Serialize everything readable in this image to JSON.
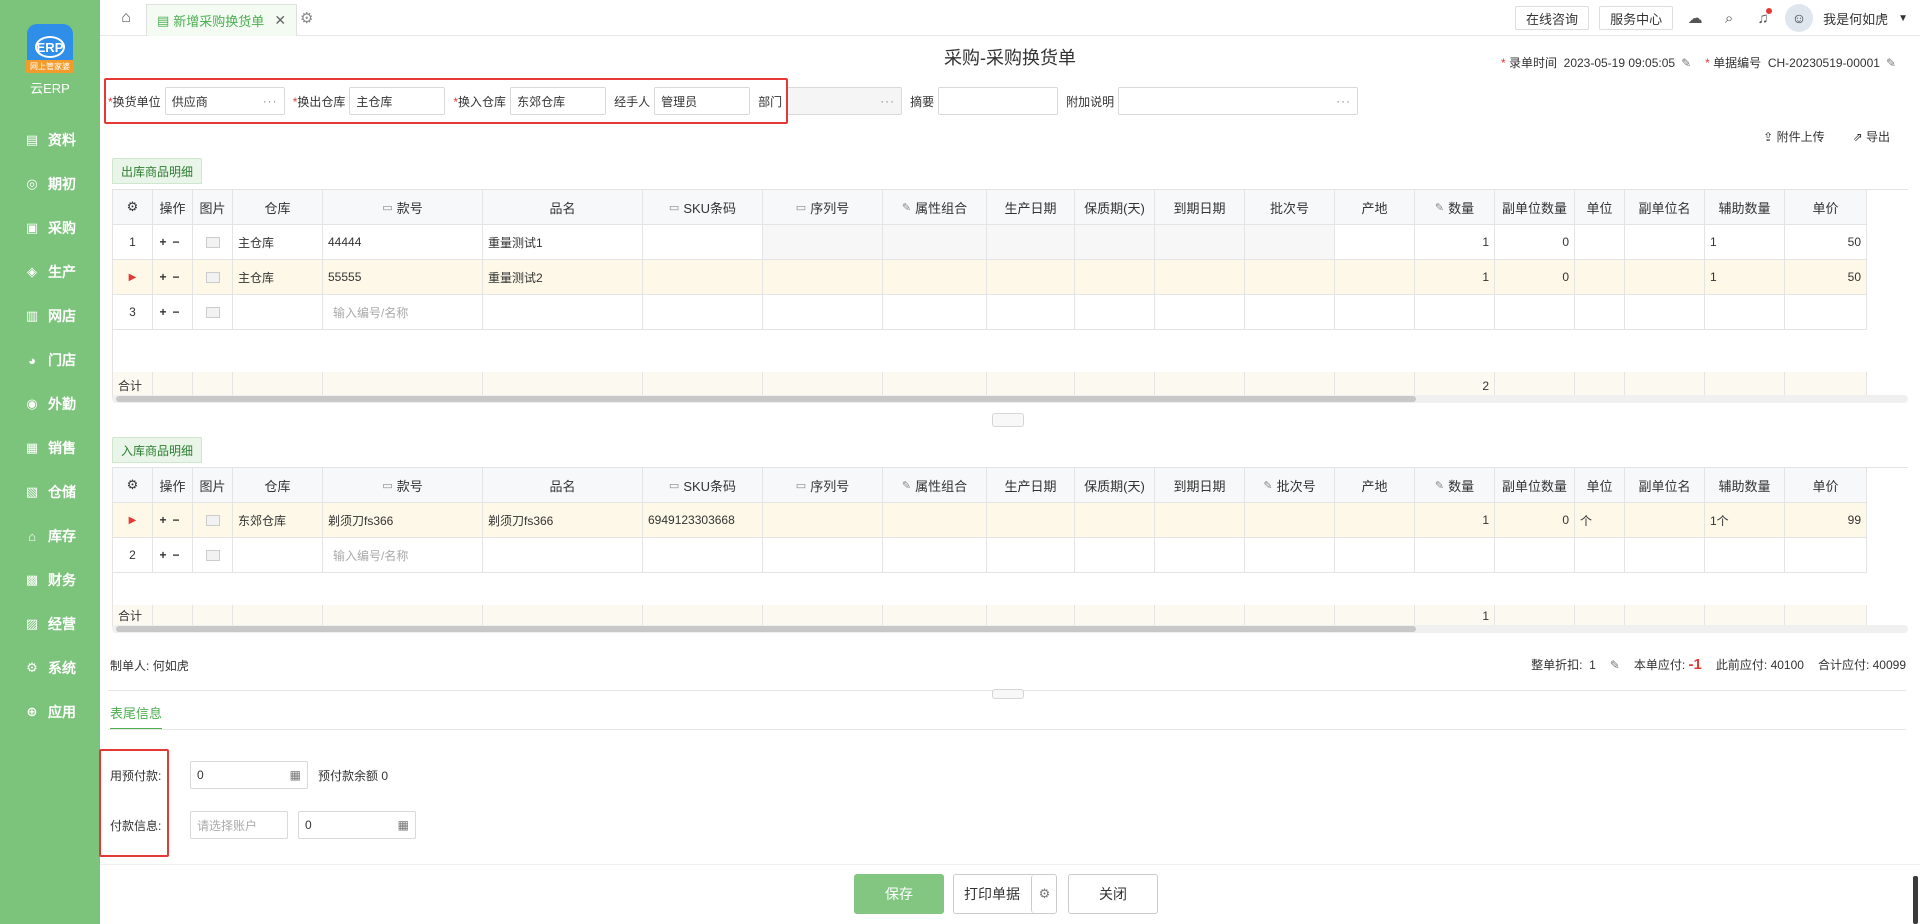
{
  "app": {
    "logo_text": "云ERP",
    "logo_tag": "网上管家婆",
    "logo_mark": "ERP"
  },
  "sidebar": {
    "items": [
      {
        "label": "资料",
        "icon": "file-icon"
      },
      {
        "label": "期初",
        "icon": "clock-icon"
      },
      {
        "label": "采购",
        "icon": "cart-icon"
      },
      {
        "label": "生产",
        "icon": "factory-icon"
      },
      {
        "label": "网店",
        "icon": "shop-icon"
      },
      {
        "label": "门店",
        "icon": "store-icon"
      },
      {
        "label": "外勤",
        "icon": "location-icon"
      },
      {
        "label": "销售",
        "icon": "chart-icon"
      },
      {
        "label": "仓储",
        "icon": "warehouse-icon"
      },
      {
        "label": "库存",
        "icon": "home-icon"
      },
      {
        "label": "财务",
        "icon": "finance-icon"
      },
      {
        "label": "经营",
        "icon": "business-icon"
      },
      {
        "label": "系统",
        "icon": "gear-icon"
      },
      {
        "label": "应用",
        "icon": "plus-icon"
      }
    ]
  },
  "topbar": {
    "tab_label": "新增采购换货单",
    "online_consult": "在线咨询",
    "service_center": "服务中心",
    "user_name": "我是何如虎"
  },
  "page": {
    "title": "采购-采购换货单",
    "entry_time_label": "录单时间",
    "entry_time": "2023-05-19 09:05:05",
    "doc_no_label": "单据编号",
    "doc_no": "CH-20230519-00001"
  },
  "form": {
    "unit_label": "换货单位",
    "unit_value": "供应商",
    "out_wh_label": "换出仓库",
    "out_wh_value": "主仓库",
    "in_wh_label": "换入仓库",
    "in_wh_value": "东郊仓库",
    "handler_label": "经手人",
    "handler_value": "管理员",
    "dept_label": "部门",
    "dept_value": "",
    "summary_label": "摘要",
    "summary_value": "",
    "remark_label": "附加说明",
    "remark_value": "",
    "attach_label": "附件上传",
    "export_label": "导出"
  },
  "columns": [
    "操作",
    "图片",
    "仓库",
    "款号",
    "品名",
    "SKU条码",
    "序列号",
    "属性组合",
    "生产日期",
    "保质期(天)",
    "到期日期",
    "批次号",
    "产地",
    "数量",
    "副单位数量",
    "单位",
    "副单位名",
    "辅助数量",
    "单价"
  ],
  "outbound": {
    "section_label": "出库商品明细",
    "rows": [
      {
        "idx": "1",
        "wh": "主仓库",
        "code": "44444",
        "name": "重量测试1",
        "sku": "",
        "qty": "1",
        "subqty": "0",
        "unit": "",
        "aux": "1",
        "price": "50"
      },
      {
        "idx": "",
        "wh": "主仓库",
        "code": "55555",
        "name": "重量测试2",
        "sku": "",
        "qty": "1",
        "subqty": "0",
        "unit": "",
        "aux": "1",
        "price": "50"
      },
      {
        "idx": "3",
        "wh": "",
        "code": "",
        "name": "",
        "sku": "",
        "qty": "",
        "subqty": "",
        "unit": "",
        "aux": "",
        "price": ""
      }
    ],
    "placeholder": "输入编号/名称",
    "total_label": "合计",
    "total_qty": "2"
  },
  "inbound": {
    "section_label": "入库商品明细",
    "rows": [
      {
        "idx": "",
        "wh": "东郊仓库",
        "code": "剃须刀fs366",
        "name": "剃须刀fs366",
        "sku": "6949123303668",
        "qty": "1",
        "subqty": "0",
        "unit": "个",
        "aux": "1个",
        "price": "99"
      },
      {
        "idx": "2",
        "wh": "",
        "code": "",
        "name": "",
        "sku": "",
        "qty": "",
        "subqty": "",
        "unit": "",
        "aux": "",
        "price": ""
      }
    ],
    "placeholder": "输入编号/名称",
    "total_label": "合计",
    "total_qty": "1"
  },
  "footer_info": {
    "maker_label": "制单人:",
    "maker": "何如虎",
    "discount_label": "整单折扣:",
    "discount": "1",
    "payable_label": "本单应付:",
    "payable": "-1",
    "prev_payable_label": "此前应付:",
    "prev_payable": "40100",
    "total_payable_label": "合计应付:",
    "total_payable": "40099",
    "tail_tab": "表尾信息",
    "prepay_label": "用预付款:",
    "prepay_value": "0",
    "prepay_balance_label": "预付款余额",
    "prepay_balance": "0",
    "payinfo_label": "付款信息:",
    "account_placeholder": "请选择账户",
    "pay_amount": "0"
  },
  "buttons": {
    "save": "保存",
    "print": "打印单据",
    "close": "关闭"
  },
  "colors": {
    "sidebar_bg": "#7cc37c",
    "accent": "#4caf50",
    "highlight_border": "#e53935",
    "row_highlight": "#fdf8e8"
  }
}
